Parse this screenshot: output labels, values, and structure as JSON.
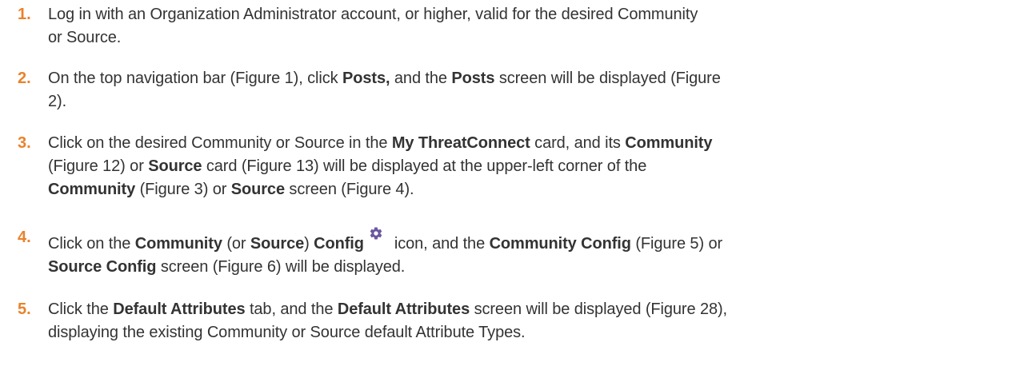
{
  "accent_color": "#e9822b",
  "text_color": "#333333",
  "icon_color": "#6b57a0",
  "steps": [
    {
      "number": "1.",
      "lines": [
        [
          "Log in with an Organization Administrator account, or higher, valid for the desired Community"
        ],
        [
          "or Source."
        ]
      ]
    },
    {
      "number": "2.",
      "l1a": "On the top navigation bar (Figure 1), click ",
      "l1b": "Posts,",
      "l1c": " and the ",
      "l1d": "Posts",
      "l1e": " screen will be displayed (Figure",
      "l2a": "2)."
    },
    {
      "number": "3.",
      "l1a": "Click on the desired Community or Source in the ",
      "l1b": "My ThreatConnect",
      "l1c": " card, and its ",
      "l1d": "Community",
      "l2a": "(Figure 12) or ",
      "l2b": "Source",
      "l2c": " card (Figure 13) will be displayed at the upper-left corner of the",
      "l3a": "Community",
      "l3b": " (Figure 3) or ",
      "l3c": "Source",
      "l3d": " screen (Figure 4)."
    },
    {
      "number": "4.",
      "l1a": "Click on the ",
      "l1b": "Community",
      "l1c": " (or ",
      "l1d": "Source",
      "l1e": ") ",
      "l1f": "Config",
      "l1g": "icon, and the ",
      "l1h": "Community Config",
      "l1i": " (Figure 5) or",
      "l2a": "Source Config",
      "l2b": " screen (Figure 6) will be displayed.",
      "icon": "gear-icon"
    },
    {
      "number": "5.",
      "l1a": "Click the ",
      "l1b": "Default Attributes",
      "l1c": " tab, and the ",
      "l1d": "Default Attributes",
      "l1e": " screen will be displayed (Figure 28),",
      "l2a": "displaying the existing Community or Source default Attribute Types."
    }
  ]
}
